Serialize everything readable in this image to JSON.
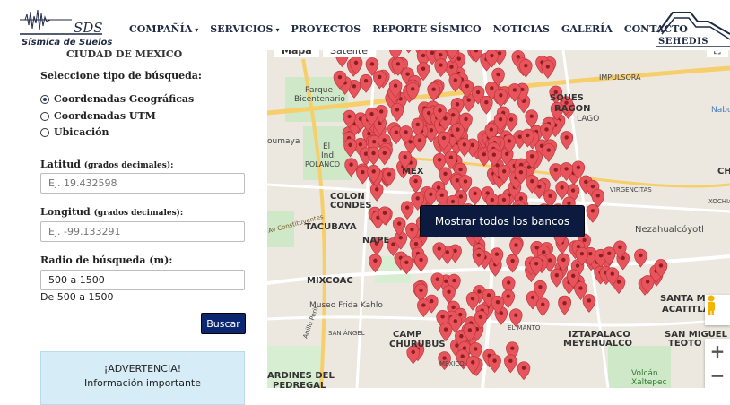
{
  "header": {
    "logo_text": "SDS",
    "logo_sub": "Sísmica de Suelos",
    "nav": [
      {
        "label": "COMPAÑÍA",
        "caret": "▾"
      },
      {
        "label": "SERVICIOS",
        "caret": "▾"
      },
      {
        "label": "PROYECTOS",
        "caret": ""
      },
      {
        "label": "REPORTE SÍSMICO",
        "caret": ""
      },
      {
        "label": "NOTICIAS",
        "caret": ""
      },
      {
        "label": "GALERÍA",
        "caret": ""
      },
      {
        "label": "CONTACTO",
        "caret": ""
      }
    ],
    "partner_logo": "SEHEDIS"
  },
  "panel": {
    "cut_title": "CIUDAD DE MÉXICO",
    "search_type_label": "Seleccione tipo de búsqueda:",
    "options": [
      {
        "label": "Coordenadas Geográficas",
        "selected": true
      },
      {
        "label": "Coordenadas UTM",
        "selected": false
      },
      {
        "label": "Ubicación",
        "selected": false
      }
    ],
    "lat_label": "Latitud",
    "lat_unit": "(grados decimales):",
    "lat_placeholder": "Ej. 19.432598",
    "lon_label": "Longitud",
    "lon_unit": "(grados decimales):",
    "lon_placeholder": "Ej. -99.133291",
    "radius_label": "Radio de búsqueda (m):",
    "radius_value": "500 a 1500",
    "radius_hint": "De 500 a 1500",
    "search_button": "Buscar",
    "warning_title": "¡ADVERTENCIA!",
    "warning_text": "Información importante"
  },
  "map": {
    "tabs": [
      "Mapa",
      "Satélite"
    ],
    "show_all_button": "Mostrar todos los bancos",
    "labels": {
      "parque": "Parque",
      "bicentenario": "Bicentenario",
      "impulsora": "IMPULSORA",
      "sques": "SQUES",
      "ragon": "RAGON",
      "lago": "LAGO",
      "naboc": "Nabo",
      "oumaya": "oumaya",
      "el": "El",
      "indi": "Indi",
      "polanco": "POLANCO",
      "mex": "MEX",
      "colon": "COLON",
      "condes": "CONDES",
      "virgencitas": "VIRGENCITAS",
      "xochiac": "XOCHIAC",
      "constituyentes": "Av Constituyentes",
      "tacubaya": "TACUBAYA",
      "nezahualcoyotl": "Nezahualcóyotl",
      "nape": "NAPE",
      "mixcoac": "MIXCOAC",
      "frida": "Museo Frida Kahlo",
      "santa_martha": "SANTA MARTHA",
      "acatitla": "ACATITLA",
      "el_manto": "EL MANTO",
      "san_angel": "SAN ÁNGEL",
      "camp": "CAMP",
      "churubus": "CHURUBUS",
      "iztacalco": "IZTAPALACO",
      "meyehualco": "MEYEHUALCO",
      "san_miguel": "SAN MIGUEL",
      "teoton": "TEOTO",
      "mexico": "MÉXICO",
      "volcan": "Volcán",
      "xaltepec": "Xaltepec",
      "jardines": "ARDINES DEL",
      "pedregal": "PEDREGAL",
      "anillo": "Anillo Perif",
      "ch": "CH"
    },
    "marker_color": "#e8545b",
    "zoom_in": "+",
    "zoom_out": "−"
  }
}
